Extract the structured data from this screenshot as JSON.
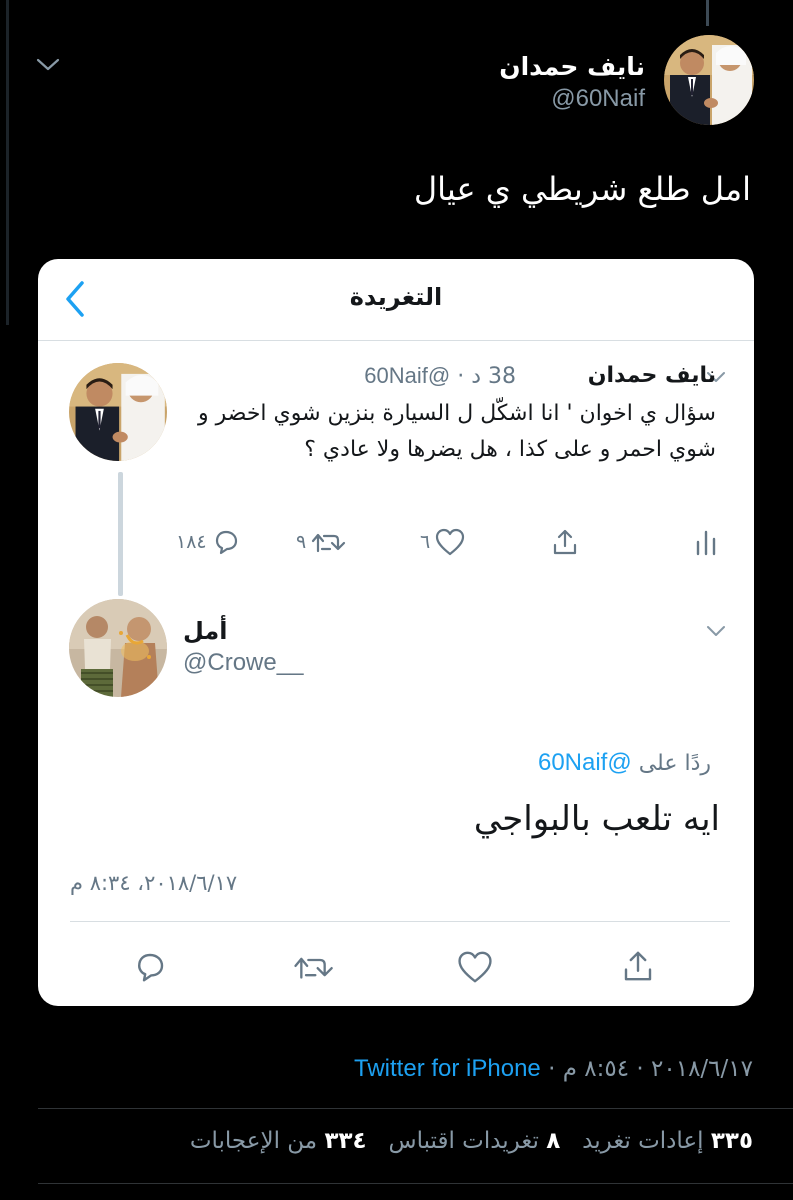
{
  "tweet": {
    "author_name": "نايف حمدان",
    "author_handle": "@60Naif",
    "text": "امل طلع شريطي ي عيال",
    "timestamp": "٢٠١٨/٦/١٧ · ٨:٥٤ م",
    "source": "Twitter for iPhone",
    "stats": {
      "retweets_count": "٣٣٥",
      "retweets_label": "إعادات تغريد",
      "quotes_count": "٨",
      "quotes_label": "تغريدات اقتباس",
      "likes_count": "٣٣٤",
      "likes_label": "من الإعجابات"
    }
  },
  "screenshot": {
    "title": "التغريدة",
    "quoted": {
      "name": "نايف حمدان",
      "handle": "@60Naif",
      "time_ago": "38 د",
      "text": "سؤال ي اخوان ' انا اشكّل ل السيارة بنزين شوي اخضر و شوي احمر و على كذا ، هل يضرها ولا عادي ؟",
      "replies": "١٨٤",
      "retweets": "٩",
      "likes": "٦"
    },
    "reply": {
      "name": "أمل",
      "handle": "@Crowe__",
      "reply_to_label": "ردًا على",
      "reply_to_handle": "@60Naif",
      "text": "ايه تلعب بالبواجي",
      "timestamp": "٢٠١٨/٦/١٧، ٨:٣٤ م"
    }
  },
  "colors": {
    "background": "#000000",
    "accent": "#1da1f2",
    "muted": "#8899a6",
    "card": "#ffffff"
  },
  "icons": [
    "chevron-down-icon",
    "back-arrow-icon",
    "reply-icon",
    "retweet-icon",
    "like-icon",
    "share-icon",
    "analytics-icon"
  ]
}
